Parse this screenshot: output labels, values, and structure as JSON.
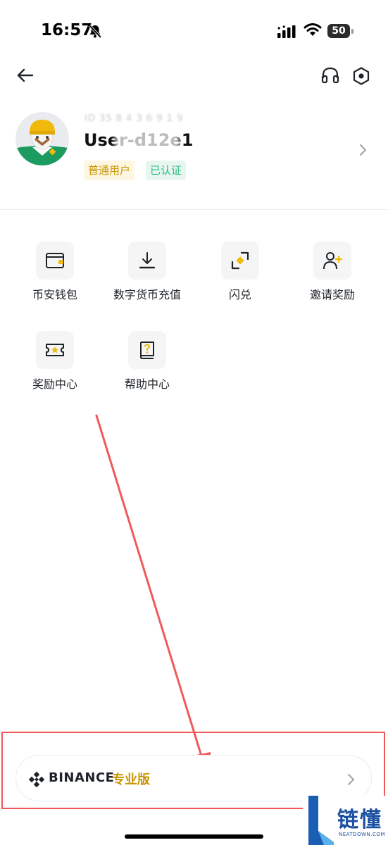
{
  "status_bar": {
    "time": "16:57",
    "battery": "50"
  },
  "profile": {
    "uid": "ID 35 8 4 3 6 9 1 9",
    "username": "User-d12e1",
    "badges": [
      "普通用户",
      "已认证"
    ]
  },
  "menu": {
    "items": [
      {
        "label": "币安钱包",
        "icon": "wallet-icon"
      },
      {
        "label": "数字货币充值",
        "icon": "download-icon"
      },
      {
        "label": "闪兑",
        "icon": "convert-icon"
      },
      {
        "label": "邀请奖励",
        "icon": "add-user-icon"
      },
      {
        "label": "奖励中心",
        "icon": "ticket-icon"
      },
      {
        "label": "帮助中心",
        "icon": "help-book-icon"
      }
    ]
  },
  "pro_switch": {
    "brand": "BINANCE",
    "label": "专业版"
  },
  "watermark": {
    "text": "链懂",
    "sub": "NEATDOWN.COM"
  },
  "colors": {
    "accent_yellow": "#F0B90B",
    "gold_text": "#C99400",
    "green": "#2EBD85",
    "annotation_red": "#F05A5A"
  }
}
